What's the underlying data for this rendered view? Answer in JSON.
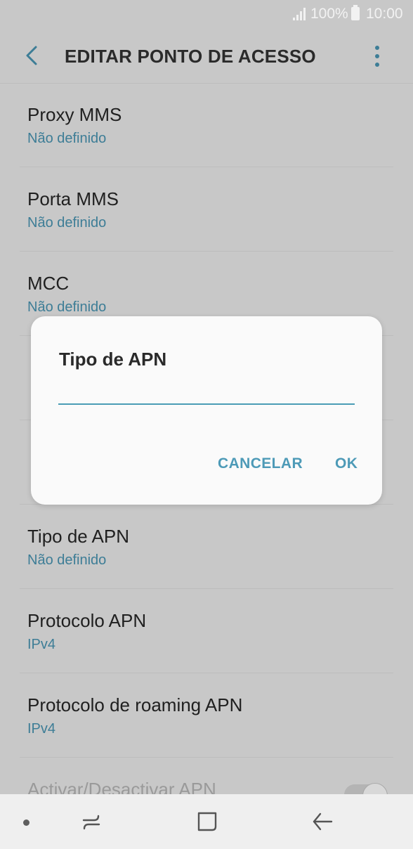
{
  "status_bar": {
    "battery_percent": "100%",
    "time": "10:00",
    "icons": [
      "signal-icon",
      "battery-icon"
    ]
  },
  "app_bar": {
    "title": "EDITAR PONTO DE ACESSO",
    "icons": [
      "back-arrow-icon",
      "more-options-icon"
    ]
  },
  "settings_list": [
    {
      "label": "Proxy MMS",
      "value": "Não definido"
    },
    {
      "label": "Porta MMS",
      "value": "Não definido"
    },
    {
      "label": "MCC",
      "value": "Não definido"
    },
    {
      "label": "",
      "value": ""
    },
    {
      "label": "",
      "value": ""
    },
    {
      "label": "Tipo de APN",
      "value": "Não definido"
    },
    {
      "label": "Protocolo APN",
      "value": "IPv4"
    },
    {
      "label": "Protocolo de roaming APN",
      "value": "IPv4"
    },
    {
      "label": "Activar/Desactivar APN",
      "value": "",
      "toggle": true
    }
  ],
  "dialog": {
    "title": "Tipo de APN",
    "input_value": "",
    "cancel_label": "CANCELAR",
    "ok_label": "OK"
  },
  "nav_bar": {
    "icons": [
      "dot-indicator-icon",
      "recent-apps-icon",
      "home-icon",
      "back-icon"
    ]
  },
  "colors": {
    "accent": "#4d9ab7",
    "value_text": "#3d7d96",
    "dimmed_background": "#c8c8c8"
  }
}
